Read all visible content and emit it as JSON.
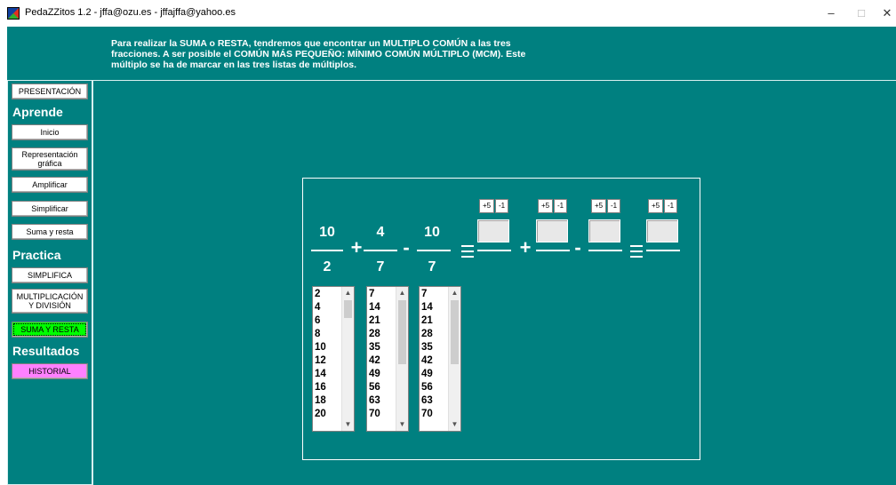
{
  "window": {
    "title": "PedaZZitos 1.2 - jffa@ozu.es - jffajffa@yahoo.es",
    "minimize": "–",
    "maximize": "□",
    "close": "✕"
  },
  "instructions": "Para realizar la SUMA o RESTA, tendremos que encontrar un MULTIPLO COMÚN a las tres fracciones. A ser posible el COMÚN MÁS PEQUEÑO: MÍNIMO COMÚN MÚLTIPLO (MCM). Este múltiplo se ha de marcar en las tres listas de múltiplos.",
  "sidebar": {
    "presentacion": "PRESENTACIÓN",
    "aprende_label": "Aprende",
    "aprende": [
      "Inicio",
      "Representación gráfica",
      "Amplificar",
      "Simplificar",
      "Suma y resta"
    ],
    "practica_label": "Practica",
    "practica": [
      "SIMPLIFICA",
      "MULTIPLICACIÓN Y DIVISIÓN",
      "SUMA Y RESTA"
    ],
    "resultados_label": "Resultados",
    "historial": "HISTORIAL"
  },
  "colors": {
    "background": "#008080",
    "active_button": "#00ff00",
    "historial_button": "#ff80ff"
  },
  "exercise": {
    "fractions": [
      {
        "numerator": "10",
        "denominator": "2"
      },
      {
        "numerator": "4",
        "denominator": "7"
      },
      {
        "numerator": "10",
        "denominator": "7"
      }
    ],
    "operators": [
      "+",
      "-",
      "+",
      "-"
    ],
    "step_buttons": {
      "plus": "+5",
      "minus": "-1"
    },
    "lists": [
      [
        "2",
        "4",
        "6",
        "8",
        "10",
        "12",
        "14",
        "16",
        "18",
        "20"
      ],
      [
        "7",
        "14",
        "21",
        "28",
        "35",
        "42",
        "49",
        "56",
        "63",
        "70"
      ],
      [
        "7",
        "14",
        "21",
        "28",
        "35",
        "42",
        "49",
        "56",
        "63",
        "70"
      ]
    ]
  }
}
